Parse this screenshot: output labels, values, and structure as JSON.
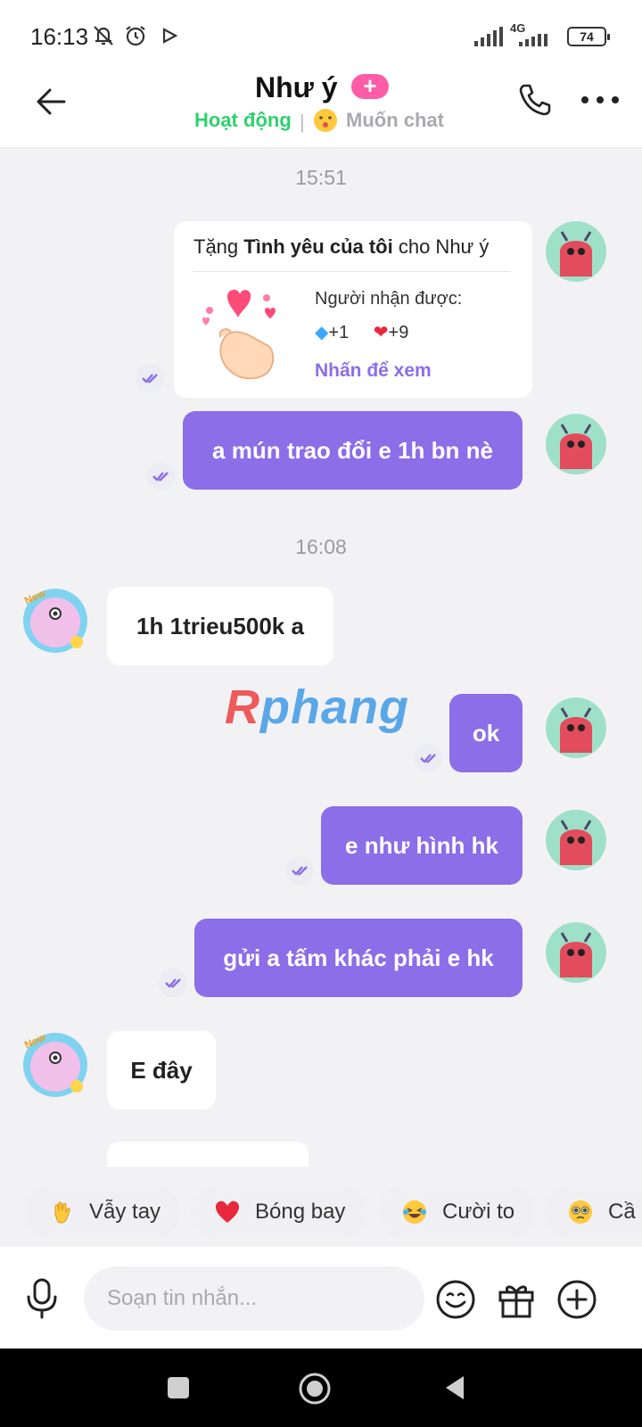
{
  "status_bar": {
    "time": "16:13",
    "network": "4G",
    "battery": "74"
  },
  "header": {
    "name": "Như ý",
    "plus_badge": "+",
    "status": "Hoạt động",
    "separator": "|",
    "want_chat": "Muốn chat"
  },
  "chat": {
    "time1": "15:51",
    "gift": {
      "prefix": "Tặng ",
      "gift_name": "Tình yêu của tôi",
      "suffix": " cho Như ý",
      "receiver_label": "Người nhận được:",
      "diamond_value": "+1",
      "heart_value": "+9",
      "view_link": "Nhấn để xem"
    },
    "msg_out_1": "a mún trao đổi e 1h bn nè",
    "time2": "16:08",
    "msg_in_1": "1h 1trieu500k a",
    "msg_out_2": "ok",
    "msg_out_3": "e như hình hk",
    "msg_out_4": "gửi a tấm khác phải e hk",
    "msg_in_2": "E đây",
    "watermark_a": "R",
    "watermark_b": "phang"
  },
  "quick_replies": [
    {
      "label": "Vẫy tay",
      "icon": "waving-hand-icon"
    },
    {
      "label": "Bóng bay",
      "icon": "heart-icon"
    },
    {
      "label": "Cười to",
      "icon": "laughing-face-icon"
    },
    {
      "label": "Cầ",
      "icon": "pleading-face-icon"
    }
  ],
  "composer": {
    "placeholder": "Soạn tin nhắn..."
  },
  "colors": {
    "accent": "#8b6ee8",
    "online": "#2ed16d",
    "pink": "#ff5ca8"
  }
}
